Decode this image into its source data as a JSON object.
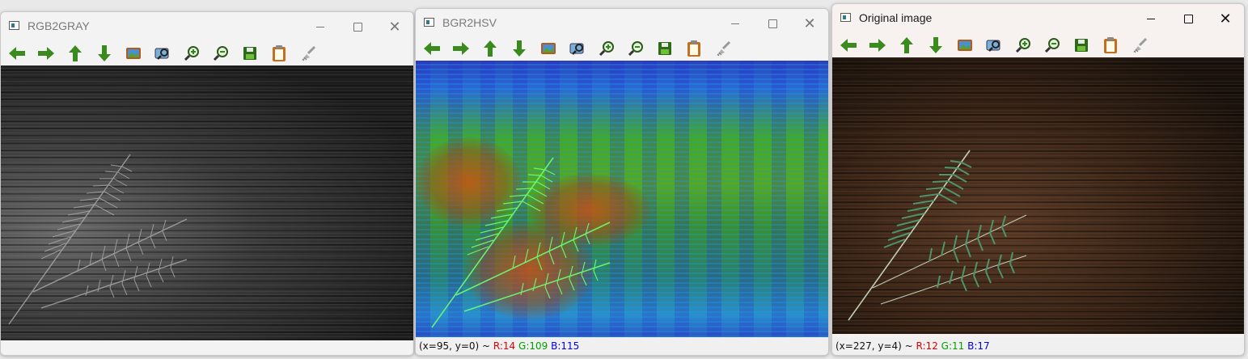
{
  "windows": [
    {
      "id": "gray",
      "title": "RGB2GRAY",
      "active": false,
      "status": null
    },
    {
      "id": "hsv",
      "title": "BGR2HSV",
      "active": false,
      "status": {
        "coords": "(x=95, y=0) ~",
        "r": "R:14",
        "g": "G:109",
        "b": "B:115"
      }
    },
    {
      "id": "original",
      "title": "Original image",
      "active": true,
      "status": {
        "coords": "(x=227, y=4) ~",
        "r": "R:12",
        "g": "G:11",
        "b": "B:17"
      }
    }
  ],
  "toolbar_icons": [
    "pan-left-icon",
    "pan-right-icon",
    "pan-up-icon",
    "pan-down-icon",
    "zoom-original-icon",
    "zoom-fit-icon",
    "zoom-in-icon",
    "zoom-out-icon",
    "save-icon",
    "copy-clipboard-icon",
    "properties-icon"
  ],
  "colors": {
    "arrow_green": "#3a8a1e",
    "status_red": "#e00000",
    "status_green": "#00a000",
    "status_blue": "#0000e0"
  }
}
